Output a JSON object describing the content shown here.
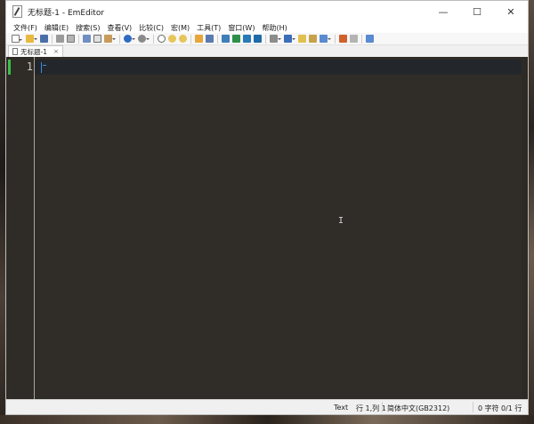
{
  "window": {
    "title": "无标题-1 - EmEditor",
    "controls": {
      "minimize": "—",
      "maximize": "☐",
      "close": "✕"
    }
  },
  "menu": [
    "文件(F)",
    "编辑(E)",
    "搜索(S)",
    "查看(V)",
    "比较(C)",
    "宏(M)",
    "工具(T)",
    "窗口(W)",
    "帮助(H)"
  ],
  "tabs": [
    {
      "label": "无标题-1",
      "close": "×"
    }
  ],
  "editor": {
    "line_numbers": [
      "1"
    ],
    "cursor_glyph": "I"
  },
  "status": {
    "mode": "Text",
    "position": "行 1,列 1",
    "encoding": "简体中文(GB2312)",
    "chars": "0 字符",
    "lines": "0/1 行"
  },
  "colors": {
    "editor_bg": "#302c27",
    "line_marker": "#3bbf4a",
    "caret": "#3d8ae0"
  }
}
